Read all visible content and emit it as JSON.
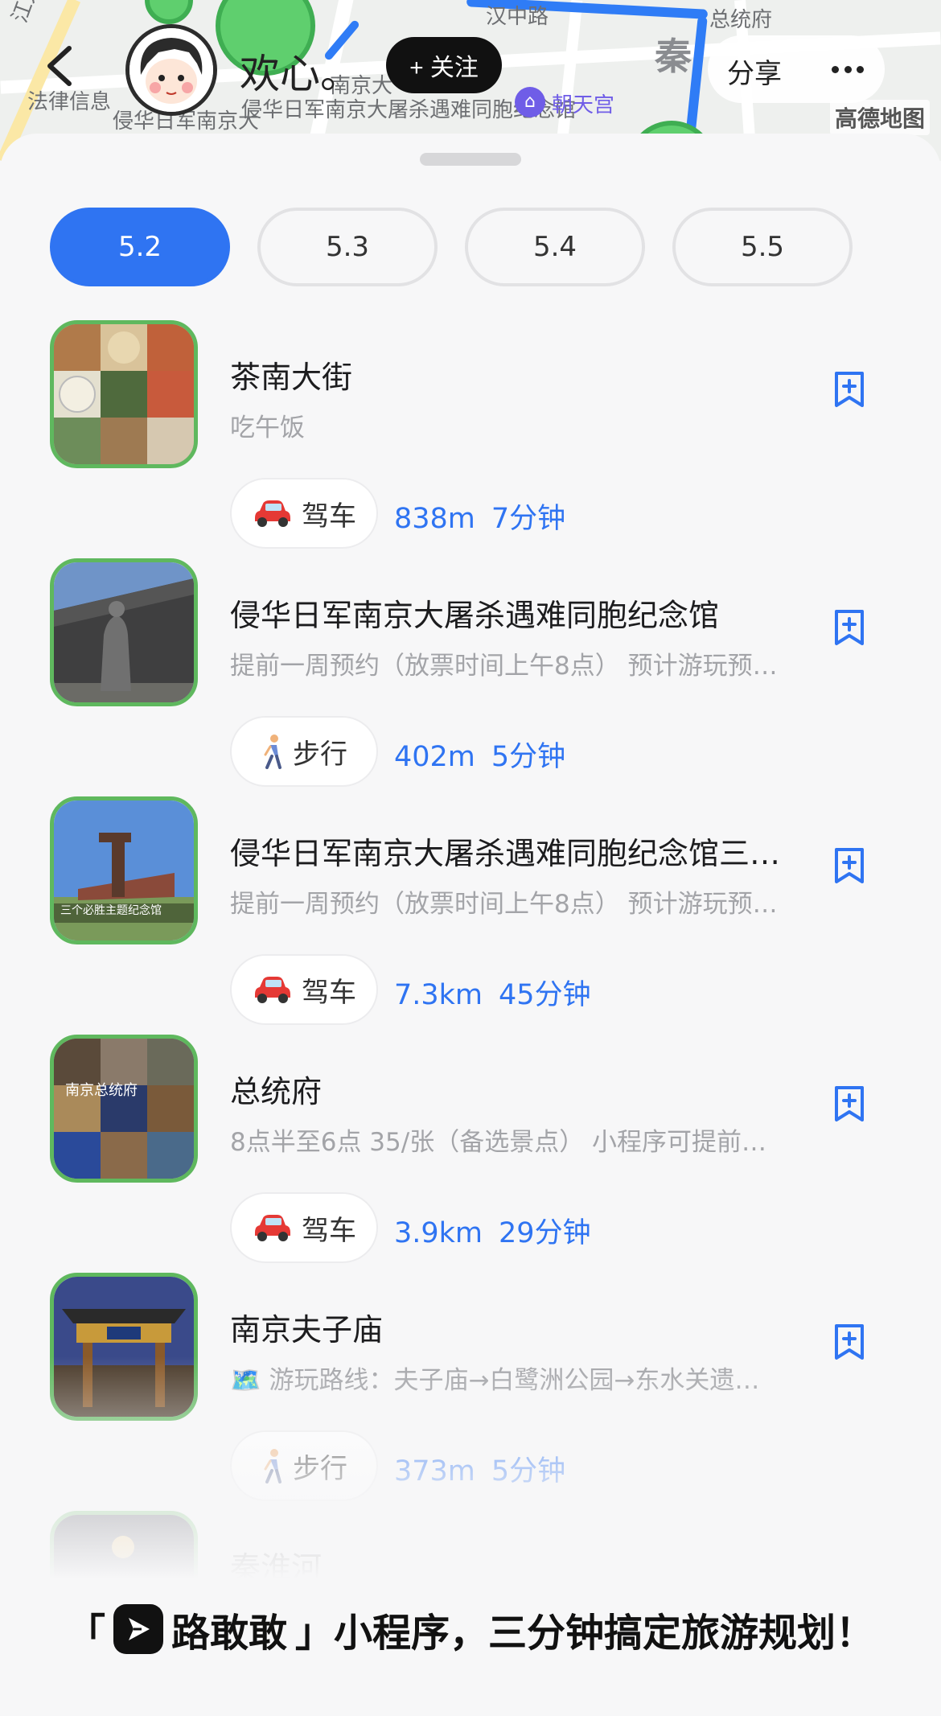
{
  "map": {
    "labels": [
      "汉中路",
      "总统府",
      "法律信息",
      "南京大",
      "侵华日军南京大屠杀遇难同胞纪念馆",
      "侵华日军南京大",
      "朝天宫",
      "江大道"
    ],
    "district": "秦",
    "brand": "高德地图",
    "poi_icon": "museum-icon"
  },
  "topbar": {
    "username": "欢心。",
    "follow_label": "+ 关注",
    "share_label": "分享",
    "more_icon": "more-dots-icon"
  },
  "tabs": [
    "5.2",
    "5.3",
    "5.4",
    "5.5"
  ],
  "active_tab": 0,
  "items": [
    {
      "title": "茶南大街",
      "subtitle": "吃午饭",
      "mode_icon": "car-icon",
      "mode": "驾车",
      "distance": "838m",
      "duration": "7分钟"
    },
    {
      "title": "侵华日军南京大屠杀遇难同胞纪念馆",
      "subtitle": "提前一周预约（放票时间上午8点） 预计游玩预…",
      "mode_icon": "walk-icon",
      "mode": "步行",
      "distance": "402m",
      "duration": "5分钟"
    },
    {
      "title": "侵华日军南京大屠杀遇难同胞纪念馆三…",
      "subtitle": "提前一周预约（放票时间上午8点） 预计游玩预…",
      "thumb_caption": "三个必胜主题纪念馆",
      "mode_icon": "car-icon",
      "mode": "驾车",
      "distance": "7.3km",
      "duration": "45分钟"
    },
    {
      "title": "总统府",
      "subtitle": "8点半至6点 35/张（备选景点） 小程序可提前…",
      "thumb_caption": "南京总统府",
      "mode_icon": "car-icon",
      "mode": "驾车",
      "distance": "3.9km",
      "duration": "29分钟"
    },
    {
      "title": "南京夫子庙",
      "subtitle": "🗺️ 游玩路线：夫子庙→白鹭洲公园→东水关遗…",
      "mode_icon": "walk-icon",
      "mode": "步行",
      "distance": "373m",
      "duration": "5分钟"
    },
    {
      "title": "秦淮河",
      "subtitle": "",
      "mode_icon": "",
      "mode": "",
      "distance": "",
      "duration": ""
    }
  ],
  "footer": {
    "open_quote": "「",
    "app_name": "路敢敢",
    "rest": "」小程序，三分钟搞定旅游规划！"
  },
  "colors": {
    "accent": "#2f74f2",
    "thumb_border": "#5fb85e",
    "route": "#2f7cf6"
  }
}
